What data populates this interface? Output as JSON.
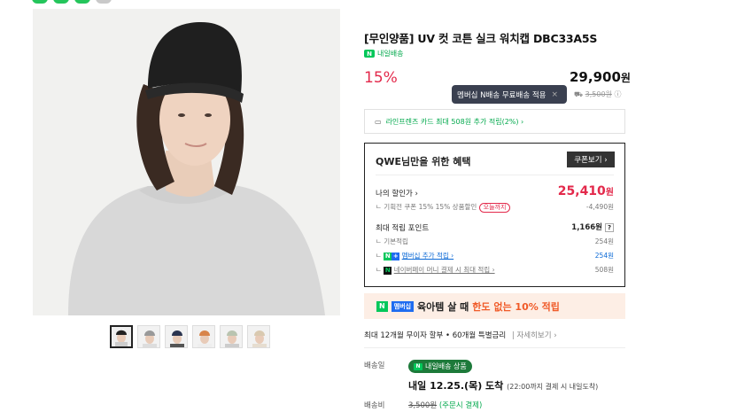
{
  "product": {
    "title": "[무인양품] UV 컷 코튼 실크 워치캡 DBC33A5S",
    "badge_label": "내일배송",
    "discount": "15%",
    "price": "29,900",
    "price_unit": "원"
  },
  "shipping_tooltip": {
    "text": "멤버십 N배송 무료배송 적용",
    "close": "×"
  },
  "shipping_small": {
    "original": "3,500원",
    "info": "ⓘ"
  },
  "card_promo": {
    "text": "라인프렌즈 카드 최대 508원 추가 적립(2%) ›"
  },
  "benefit": {
    "header": "QWE님만을 위한 혜택",
    "coupon_button": "쿠폰보기 ›",
    "my_price_label": "나의 할인가 ›",
    "my_price": "25,410",
    "my_price_unit": "원",
    "coupon_line": "기획전 쿠폰 15% 15% 상품할인",
    "coupon_tag": "오늘까지",
    "coupon_amount": "-4,490원",
    "points_label": "최대 적립 포인트",
    "points_total": "1,166원",
    "points_help": "?",
    "basic_label": "기본적립",
    "basic_value": "254원",
    "membership_label": "멤버십 추가 적립 ›",
    "membership_value": "254원",
    "npay_label": "네이버페이 머니 결제 시 최대 적립 ›",
    "npay_value": "508원"
  },
  "banner": {
    "tag_n": "N",
    "tag_membership": "멤버십",
    "text_a": "육아템 살 때",
    "text_b": "한도 없는 10% 적립"
  },
  "installment": {
    "text": "최대 12개월 무이자 할부 • 60개월 특별금리",
    "link": "자세히보기 ›"
  },
  "delivery": {
    "label": "배송일",
    "pill": "내일배송 상품",
    "arrival": "내일 12.25.(목) 도착",
    "arrival_note": "(22:00까지 결제 시 내일도착)",
    "fee_label": "배송비",
    "fee_original": "3,500원",
    "fee_note": "(주문시 결제)"
  },
  "colors": {
    "accent_red": "#e3294b",
    "naver_green": "#03c75a",
    "tooltip_bg": "#3a4050"
  }
}
